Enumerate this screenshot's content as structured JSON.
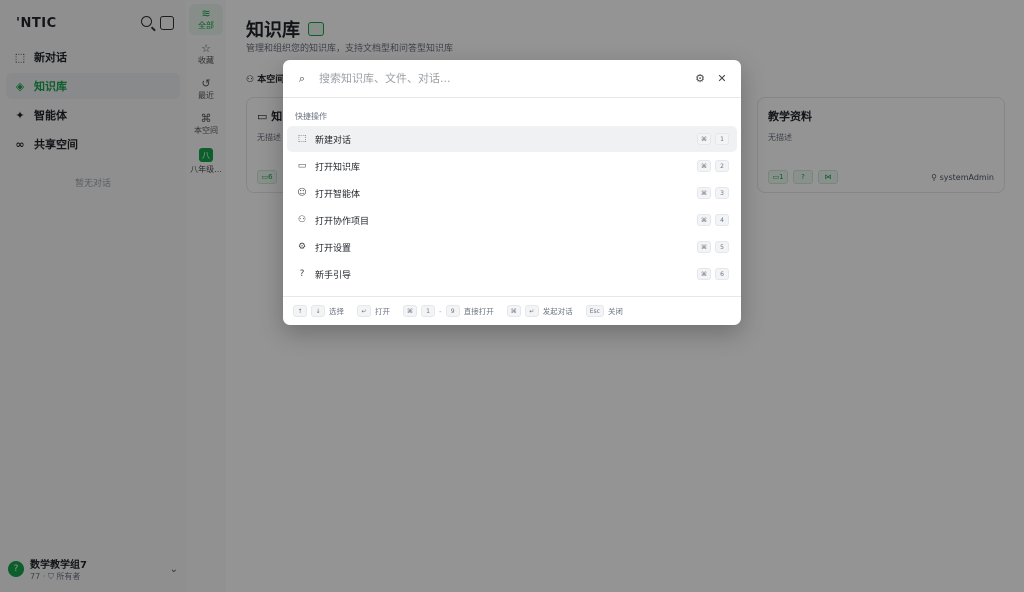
{
  "sidebar": {
    "brand": "'NTIC",
    "nav": [
      {
        "label": "新对话"
      },
      {
        "label": "知识库"
      },
      {
        "label": "智能体"
      },
      {
        "label": "共享空间"
      }
    ],
    "empty_hint": "暂无对话",
    "user": {
      "avatar": "?",
      "name": "数学教学组7",
      "sub_count": "77",
      "role": "所有者"
    }
  },
  "scope": {
    "items": [
      {
        "icon": "≋",
        "label": "全部"
      },
      {
        "icon": "☆",
        "label": "收藏"
      },
      {
        "icon": "↺",
        "label": "最近"
      },
      {
        "icon": "⌘",
        "label": "本空间"
      }
    ],
    "space": {
      "badge": "八",
      "label": "八年级..."
    }
  },
  "main": {
    "title": "知识库",
    "subtitle": "管理和组织您的知识库，支持文档型和问答型知识库",
    "filter": "本空间",
    "card_left": {
      "title": "知",
      "desc": "无描述",
      "count": "6"
    },
    "card_right": {
      "title": "教学资料",
      "desc": "无描述",
      "count": "1",
      "owner": "systemAdmin"
    }
  },
  "palette": {
    "placeholder": "搜索知识库、文件、对话...",
    "section": "快捷操作",
    "commands": [
      {
        "icon": "⬚",
        "label": "新建对话",
        "key": "1"
      },
      {
        "icon": "▭",
        "label": "打开知识库",
        "key": "2"
      },
      {
        "icon": "☺",
        "label": "打开智能体",
        "key": "3"
      },
      {
        "icon": "⚇",
        "label": "打开协作项目",
        "key": "4"
      },
      {
        "icon": "⚙",
        "label": "打开设置",
        "key": "5"
      },
      {
        "icon": "?",
        "label": "新手引导",
        "key": "6"
      }
    ],
    "cmd_key": "⌘",
    "footer": {
      "up": "↑",
      "down": "↓",
      "select": "选择",
      "enter": "↵",
      "open": "打开",
      "cmd": "⌘",
      "k1": "1",
      "dash": "-",
      "k9": "9",
      "direct_open": "直接打开",
      "cmd2": "⌘",
      "enter2": "↵",
      "send": "发起对话",
      "esc": "Esc",
      "close": "关闭"
    }
  }
}
